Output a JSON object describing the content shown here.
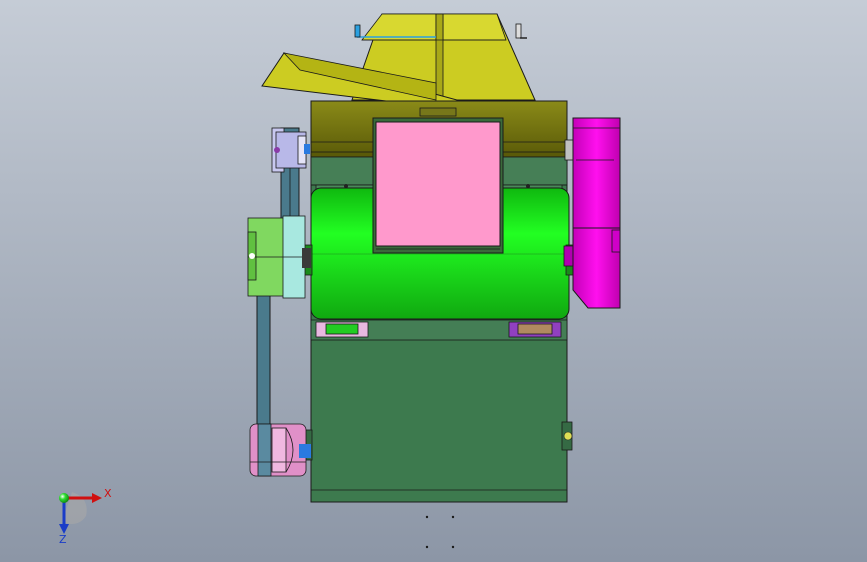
{
  "viewport": {
    "background_top": "#c5ccd6",
    "background_bottom": "#8c96a6"
  },
  "triad": {
    "x_label": "X",
    "z_label": "Z",
    "x_color": "#d01010",
    "y_color": "#18b418",
    "z_color": "#1a3cc8"
  },
  "parts": {
    "hopper_color": "#cccc22",
    "top_cover_color": "#6e6e10",
    "drum_color": "#18e218",
    "inspection_window_color": "#ff99cc",
    "gearbox_color": "#ee00dd",
    "frame_color": "#3d7a4e",
    "belt_color": "#4a7a8c",
    "pulley_top_color": "#b8b8e8",
    "pulley_mid_color": "#80d860",
    "pulley_bottom_color": "#e090c8"
  }
}
